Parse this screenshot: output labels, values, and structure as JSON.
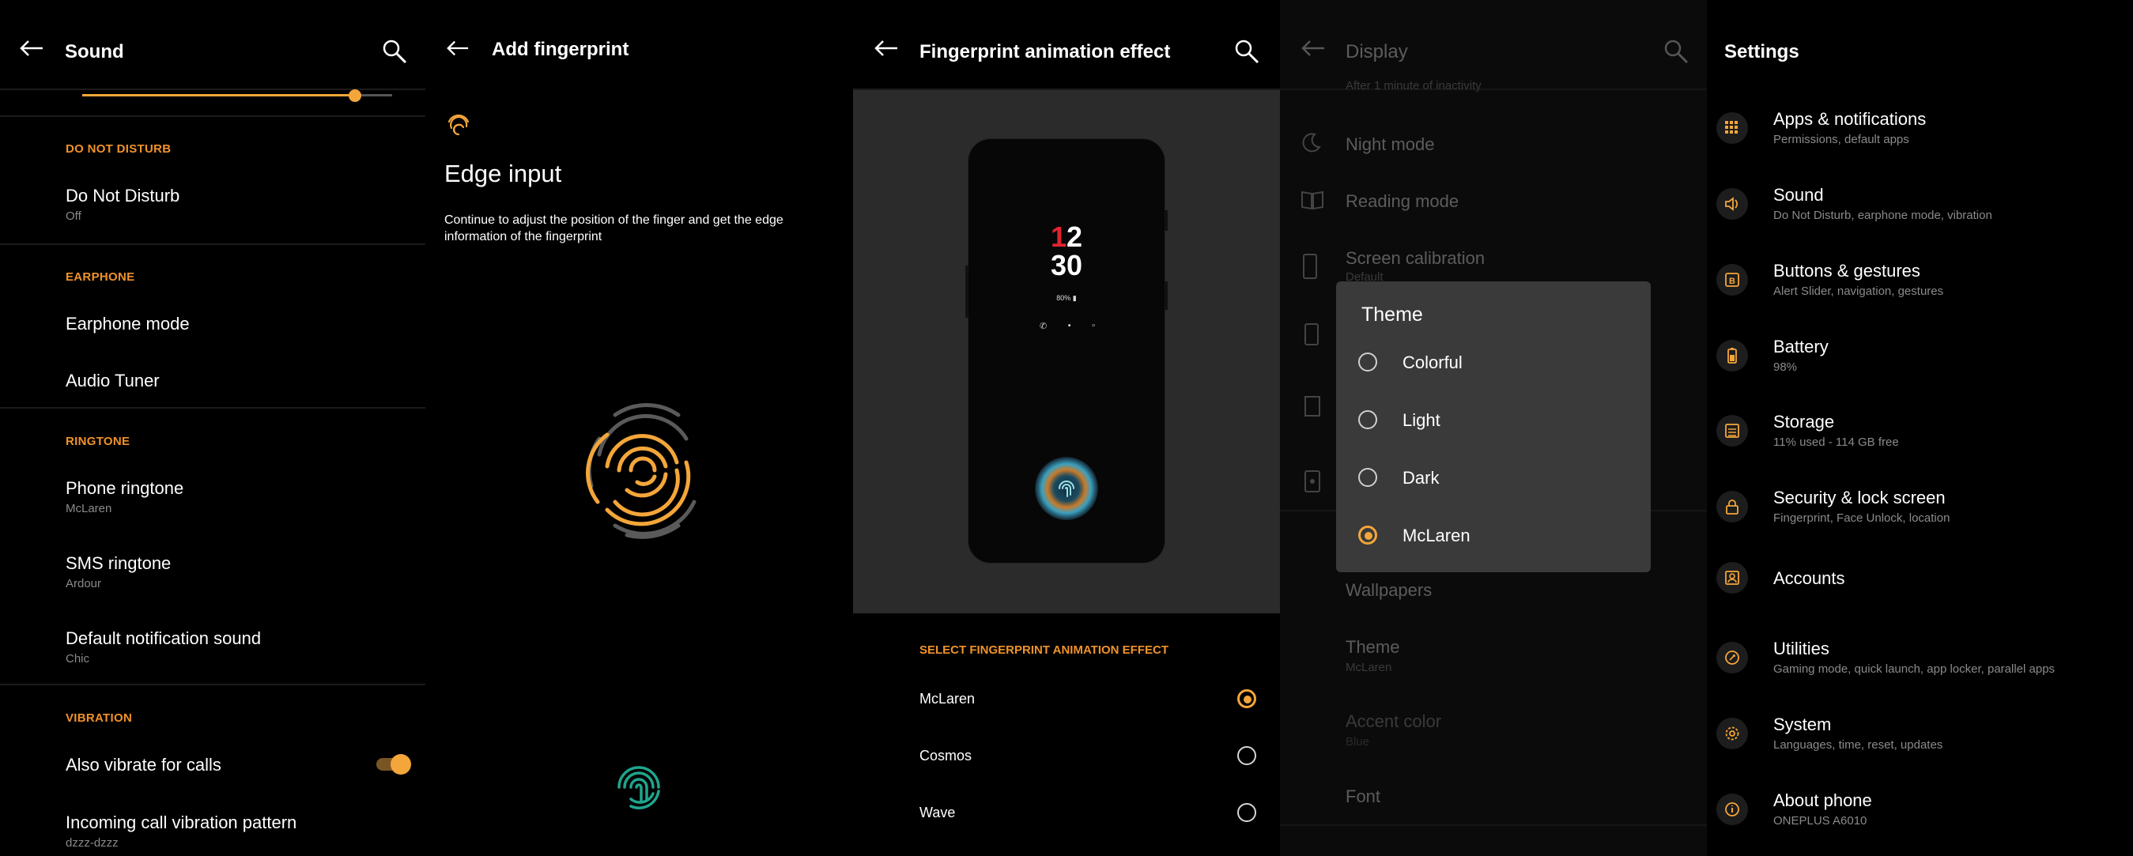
{
  "sound": {
    "title": "Sound",
    "sections": {
      "dnd_header": "DO NOT DISTURB",
      "earphone_header": "EARPHONE",
      "ringtone_header": "RINGTONE",
      "vibration_header": "VIBRATION"
    },
    "volume_level": 0.88,
    "items": {
      "dnd": {
        "title": "Do Not Disturb",
        "sub": "Off"
      },
      "earphone_mode": {
        "title": "Earphone mode"
      },
      "audio_tuner": {
        "title": "Audio Tuner"
      },
      "phone_ringtone": {
        "title": "Phone ringtone",
        "sub": "McLaren"
      },
      "sms_ringtone": {
        "title": "SMS ringtone",
        "sub": "Ardour"
      },
      "notification_sound": {
        "title": "Default notification sound",
        "sub": "Chic"
      },
      "vibrate_calls": {
        "title": "Also vibrate for calls",
        "toggle_on": true
      },
      "vibration_pattern": {
        "title": "Incoming call vibration pattern",
        "sub": "dzzz-dzzz"
      }
    }
  },
  "fingerprint": {
    "title": "Add fingerprint",
    "heading": "Edge input",
    "description": "Continue to adjust the position of the finger and get the edge information of the fingerprint"
  },
  "animation": {
    "title": "Fingerprint animation effect",
    "clock_hour_1": "1",
    "clock_hour_2": "2",
    "clock_minutes": "30",
    "battery": "80%",
    "section_header": "SELECT FINGERPRINT ANIMATION EFFECT",
    "options": [
      {
        "label": "McLaren",
        "selected": true
      },
      {
        "label": "Cosmos",
        "selected": false
      },
      {
        "label": "Wave",
        "selected": false
      }
    ]
  },
  "display": {
    "title": "Display",
    "partial_sub": "After 1 minute of inactivity",
    "items": {
      "night_mode": "Night mode",
      "reading_mode": "Reading mode",
      "screen_calibration": {
        "title": "Screen calibration",
        "sub": "Default"
      },
      "wallpapers": "Wallpapers",
      "theme": {
        "title": "Theme",
        "sub": "McLaren"
      },
      "accent_color": {
        "title": "Accent color",
        "sub": "Blue"
      },
      "font": "Font"
    },
    "dialog": {
      "title": "Theme",
      "options": [
        {
          "label": "Colorful",
          "selected": false
        },
        {
          "label": "Light",
          "selected": false
        },
        {
          "label": "Dark",
          "selected": false
        },
        {
          "label": "McLaren",
          "selected": true
        }
      ]
    }
  },
  "settings": {
    "title": "Settings",
    "items": [
      {
        "title": "Apps & notifications",
        "sub": "Permissions, default apps",
        "icon": "apps-icon"
      },
      {
        "title": "Sound",
        "sub": "Do Not Disturb, earphone mode, vibration",
        "icon": "speaker-icon"
      },
      {
        "title": "Buttons & gestures",
        "sub": "Alert Slider, navigation, gestures",
        "icon": "button-b-icon"
      },
      {
        "title": "Battery",
        "sub": "98%",
        "icon": "battery-icon"
      },
      {
        "title": "Storage",
        "sub": "11% used - 114 GB free",
        "icon": "storage-icon"
      },
      {
        "title": "Security & lock screen",
        "sub": "Fingerprint, Face Unlock, location",
        "icon": "lock-icon"
      },
      {
        "title": "Accounts",
        "sub": "",
        "icon": "account-icon"
      },
      {
        "title": "Utilities",
        "sub": "Gaming mode, quick launch, app locker, parallel apps",
        "icon": "utilities-icon"
      },
      {
        "title": "System",
        "sub": "Languages, time, reset, updates",
        "icon": "gear-icon"
      },
      {
        "title": "About phone",
        "sub": "ONEPLUS A6010",
        "icon": "info-icon"
      }
    ]
  },
  "colors": {
    "accent": "#f4a63a",
    "background": "#000000",
    "dialog_bg": "#3a3a3a"
  }
}
